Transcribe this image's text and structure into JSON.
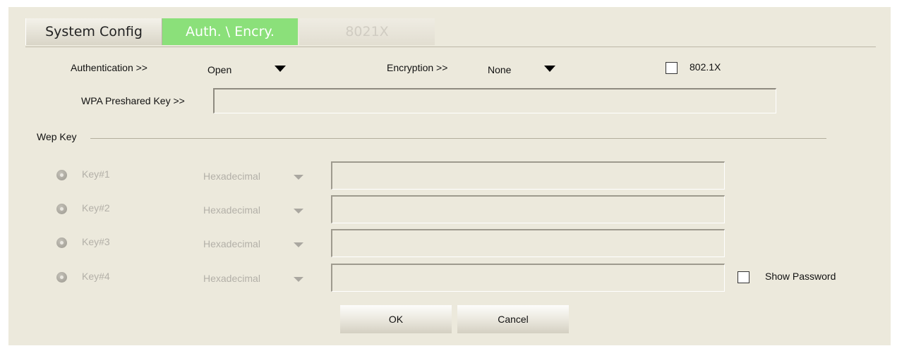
{
  "tabs": {
    "system_config": "System Config",
    "auth_encry": "Auth. \\ Encry.",
    "dot1x": "8021X"
  },
  "auth": {
    "authentication_label": "Authentication >>",
    "authentication_value": "Open",
    "encryption_label": "Encryption >>",
    "encryption_value": "None",
    "dot1x_label": "802.1X",
    "dot1x_checked": false,
    "wpa_label": "WPA Preshared Key >>",
    "wpa_value": ""
  },
  "wep": {
    "section_label": "Wep Key",
    "keys": [
      {
        "label": "Key#1",
        "format": "Hexadecimal",
        "value": ""
      },
      {
        "label": "Key#2",
        "format": "Hexadecimal",
        "value": ""
      },
      {
        "label": "Key#3",
        "format": "Hexadecimal",
        "value": ""
      },
      {
        "label": "Key#4",
        "format": "Hexadecimal",
        "value": ""
      }
    ],
    "show_password_label": "Show Password",
    "show_password_checked": false
  },
  "buttons": {
    "ok": "OK",
    "cancel": "Cancel"
  },
  "colors": {
    "active_tab": "#8be07a",
    "panel_bg": "#ece9dc"
  }
}
